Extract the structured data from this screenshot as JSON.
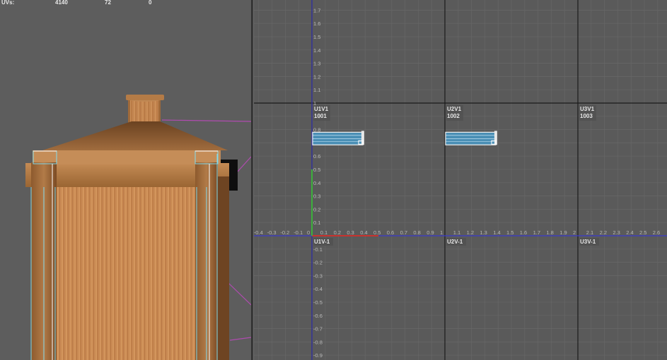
{
  "hud": {
    "uvs_label": "UVs:",
    "uvs_count": "4140",
    "uvs_selected": "72",
    "uvs_other": "0"
  },
  "uv_editor": {
    "origin_tile": {
      "udim": "1001",
      "name": "U1V1"
    },
    "tiles": [
      {
        "name": "U1V1",
        "udim": "1001"
      },
      {
        "name": "U2V1",
        "udim": "1002"
      },
      {
        "name": "U3V1",
        "udim": "1003"
      }
    ],
    "lower_tiles": [
      "U1V-1",
      "U2V-1",
      "U3V-1"
    ],
    "u_ticks": [
      "-0.4",
      "-0.3",
      "-0.2",
      "-0.1",
      "0",
      "0.1",
      "0.2",
      "0.3",
      "0.4",
      "0.5",
      "0.6",
      "0.7",
      "0.8",
      "0.9",
      "1",
      "1.1",
      "1.2",
      "1.3",
      "1.4",
      "1.5",
      "1.6",
      "1.7",
      "1.8",
      "1.9",
      "2",
      "2.1",
      "2.2",
      "2.3",
      "2.4",
      "2.5",
      "2.6"
    ],
    "v_ticks": [
      "1.7",
      "1.6",
      "1.5",
      "1.4",
      "1.3",
      "1.2",
      "1.1",
      "1",
      "0.9",
      "0.8",
      "0.7",
      "0.6",
      "0.5",
      "0.4",
      "0.3",
      "0.2",
      "0.1",
      "-0.1",
      "-0.2",
      "-0.3",
      "-0.4",
      "-0.5",
      "-0.6",
      "-0.7",
      "-0.8",
      "-0.9"
    ],
    "colors": {
      "background": "#5a5a5a",
      "grid": "#676767",
      "tile_border": "#1b1b1b",
      "u_axis": "#3a3acd",
      "v_axis": "#2a2aa8",
      "u_zero_axis": "#c8332f",
      "v_zero_axis": "#3db03d",
      "shell_fill": "#4a8fb5",
      "shell_outline": "#f0f0f0"
    }
  },
  "viewport": {
    "object": "wooden-tower",
    "colors": {
      "wood_light": "#c98d57",
      "wood_dark": "#8a5327",
      "roof": "#9c6a3f",
      "uv_wire": "#7ce6ff",
      "connector": "#b04bb0"
    }
  }
}
